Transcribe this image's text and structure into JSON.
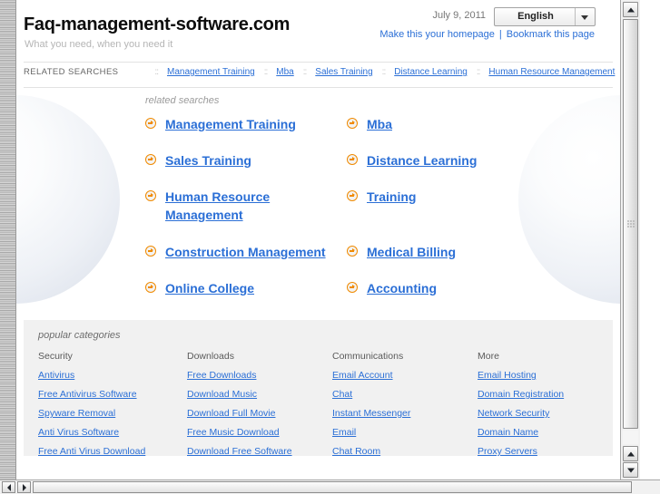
{
  "header": {
    "site_title": "Faq-management-software.com",
    "tagline": "What you need, when you need it",
    "date": "July 9, 2011",
    "language": "English",
    "homepage_link": "Make this your homepage",
    "bookmark_link": "Bookmark this page",
    "separator": "|"
  },
  "navbar": {
    "caption": "RELATED SEARCHES",
    "separator": "::",
    "items": [
      {
        "label": "Management Training"
      },
      {
        "label": "Mba"
      },
      {
        "label": "Sales Training"
      },
      {
        "label": "Distance Learning"
      },
      {
        "label": "Human Resource Management"
      }
    ]
  },
  "main": {
    "section_label": "related searches",
    "rows": [
      {
        "left": "Management Training",
        "right": "Mba"
      },
      {
        "left": "Sales Training",
        "right": "Distance Learning"
      },
      {
        "left": "Human Resource Management",
        "right": "Training"
      },
      {
        "left": "Construction Management",
        "right": "Medical Billing"
      },
      {
        "left": "Online College",
        "right": "Accounting"
      }
    ]
  },
  "categories": {
    "title": "popular categories",
    "columns": [
      {
        "heading": "Security",
        "links": [
          "Antivirus",
          "Free Antivirus Software",
          "Spyware Removal",
          "Anti Virus Software",
          "Free Anti Virus Download"
        ]
      },
      {
        "heading": "Downloads",
        "links": [
          "Free Downloads",
          "Download Music",
          "Download Full Movie",
          "Free Music Download",
          "Download Free Software"
        ]
      },
      {
        "heading": "Communications",
        "links": [
          "Email Account",
          "Chat",
          "Instant Messenger",
          "Email",
          "Chat Room"
        ]
      },
      {
        "heading": "More",
        "links": [
          "Email Hosting",
          "Domain Registration",
          "Network Security",
          "Domain Name",
          "Proxy Servers"
        ]
      }
    ]
  },
  "colors": {
    "link": "#2b6fd6",
    "accent": "#f08a00",
    "panel": "#f1f1f1"
  }
}
